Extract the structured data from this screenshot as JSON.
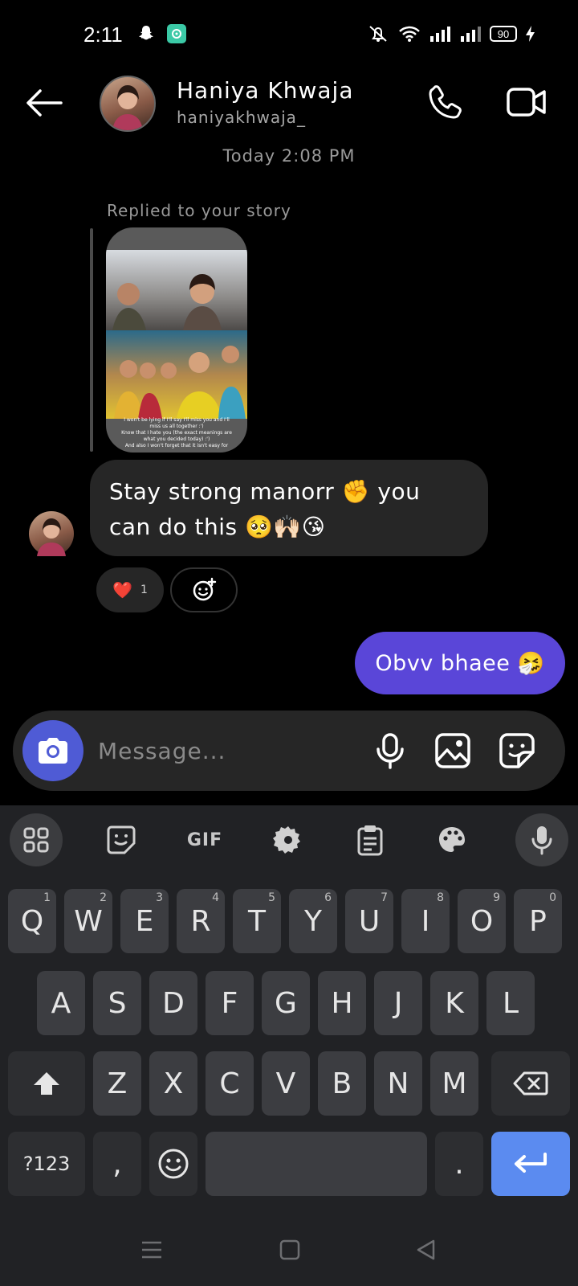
{
  "status_bar": {
    "time": "2:11",
    "battery": "90"
  },
  "header": {
    "name": "Haniya Khwaja",
    "username": "haniyakhwaja_"
  },
  "conversation": {
    "timestamp": "Today 2:08 PM",
    "story_reply_label": "Replied to your story",
    "story_caption_lines": [
      "I won't be lying if I'll say I'll miss you and I'll",
      "miss us all together :')",
      "Know that I hate you (the exact meanings are",
      "what you decided today) :')",
      "And also I won't forget that it isn't easy for"
    ],
    "incoming_message": "Stay strong manorr ✊ you can do this 🥺🙌🏻😘",
    "reaction": {
      "emoji": "❤️",
      "count": "1"
    },
    "outgoing_message": "Obvv bhaee 🤧"
  },
  "composer": {
    "placeholder": "Message..."
  },
  "keyboard": {
    "toolbar_gif": "GIF",
    "row1": [
      {
        "k": "Q",
        "h": "1"
      },
      {
        "k": "W",
        "h": "2"
      },
      {
        "k": "E",
        "h": "3"
      },
      {
        "k": "R",
        "h": "4"
      },
      {
        "k": "T",
        "h": "5"
      },
      {
        "k": "Y",
        "h": "6"
      },
      {
        "k": "U",
        "h": "7"
      },
      {
        "k": "I",
        "h": "8"
      },
      {
        "k": "O",
        "h": "9"
      },
      {
        "k": "P",
        "h": "0"
      }
    ],
    "row2": [
      "A",
      "S",
      "D",
      "F",
      "G",
      "H",
      "J",
      "K",
      "L"
    ],
    "row3": [
      "Z",
      "X",
      "C",
      "V",
      "B",
      "N",
      "M"
    ],
    "symbols_key": "?123",
    "comma_key": ",",
    "period_key": "."
  }
}
